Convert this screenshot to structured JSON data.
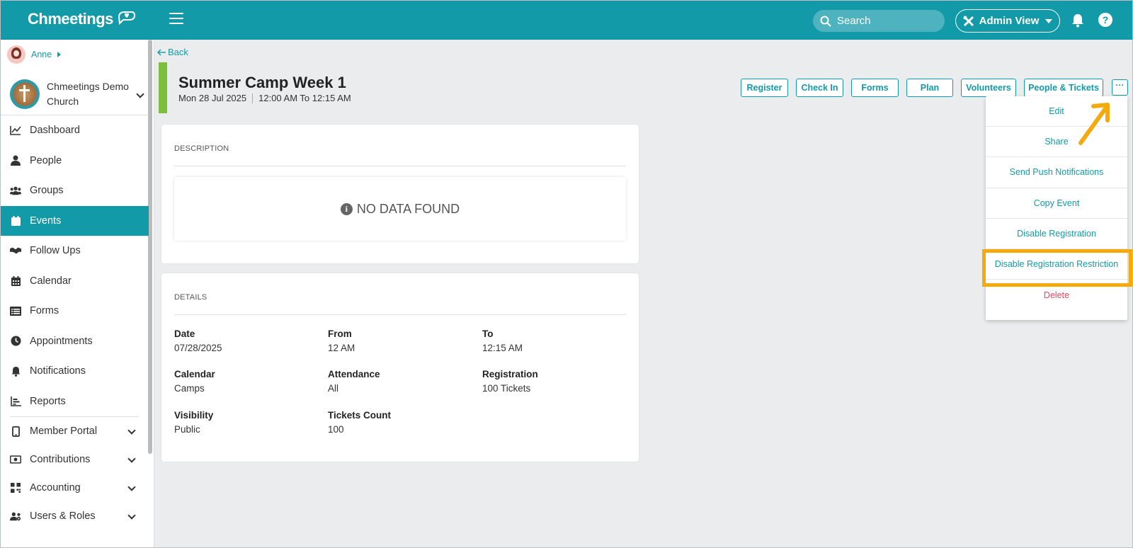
{
  "app": {
    "logo_text": "Chmeetings",
    "brand_color": "#139aa8"
  },
  "header": {
    "search_placeholder": "Search",
    "admin_view_label": "Admin View",
    "help_label": "?"
  },
  "user": {
    "name": "Anne"
  },
  "church": {
    "name": "Chmeetings Demo Church"
  },
  "sidebar": {
    "items": [
      {
        "label": "Dashboard",
        "icon": "chart-line-icon"
      },
      {
        "label": "People",
        "icon": "person-icon"
      },
      {
        "label": "Groups",
        "icon": "users-icon"
      },
      {
        "label": "Events",
        "icon": "calendar-icon",
        "active": true
      },
      {
        "label": "Follow Ups",
        "icon": "handshake-icon"
      },
      {
        "label": "Calendar",
        "icon": "calendar-grid-icon"
      },
      {
        "label": "Forms",
        "icon": "list-icon"
      },
      {
        "label": "Appointments",
        "icon": "clock-icon"
      },
      {
        "label": "Notifications",
        "icon": "bell-icon"
      },
      {
        "label": "Reports",
        "icon": "bar-chart-icon"
      }
    ],
    "expandable": [
      {
        "label": "Member Portal",
        "icon": "mobile-icon"
      },
      {
        "label": "Contributions",
        "icon": "money-icon"
      },
      {
        "label": "Accounting",
        "icon": "qr-icon"
      },
      {
        "label": "Users & Roles",
        "icon": "user-cog-icon"
      }
    ]
  },
  "page": {
    "back_label": "Back",
    "title": "Summer Camp Week 1",
    "date_text": "Mon 28 Jul  2025",
    "time_text": "12:00 AM To 12:15 AM",
    "title_bar_color": "#7cbf3c"
  },
  "actions": {
    "buttons": [
      "Register",
      "Check In",
      "Forms",
      "Plan",
      "Volunteers",
      "People & Tickets"
    ],
    "more_label": "···"
  },
  "description": {
    "heading": "DESCRIPTION",
    "empty_text": "NO DATA FOUND"
  },
  "details": {
    "heading": "DETAILS",
    "fields": [
      {
        "label": "Date",
        "value": "07/28/2025"
      },
      {
        "label": "From",
        "value": "12 AM"
      },
      {
        "label": "To",
        "value": "12:15 AM"
      },
      {
        "label": "Calendar",
        "value": "Camps"
      },
      {
        "label": "Attendance",
        "value": "All"
      },
      {
        "label": "Registration",
        "value": "100 Tickets"
      },
      {
        "label": "Visibility",
        "value": "Public"
      },
      {
        "label": "Tickets Count",
        "value": "100"
      }
    ]
  },
  "menu": {
    "items": [
      "Edit",
      "Share",
      "Send Push Notifications",
      "Copy Event",
      "Disable Registration",
      "Disable Registration Restriction"
    ],
    "danger_item": "Delete",
    "highlight_color": "#f4a90c"
  }
}
